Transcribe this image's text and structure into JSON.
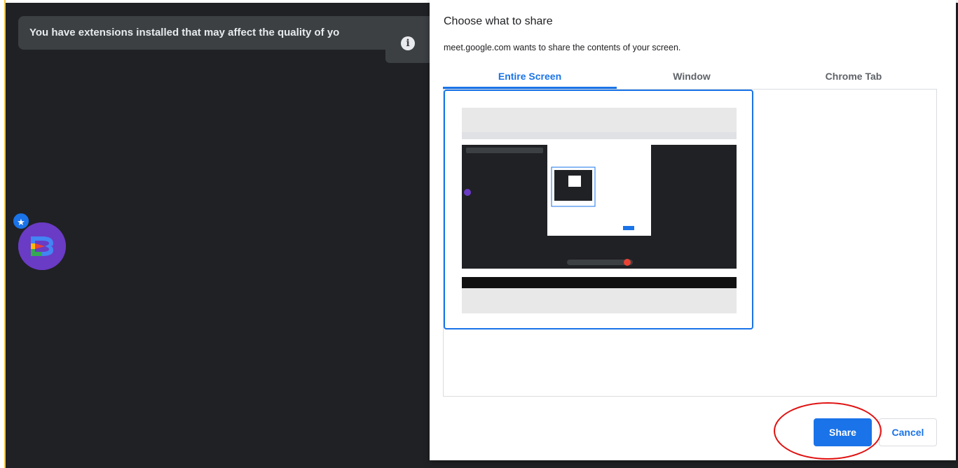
{
  "meet": {
    "extension_banner": "You have extensions installed that may affect the quality of yo",
    "info_icon": "info-icon",
    "extension_badge_icon": "star-icon",
    "extension_avatar": "extension-logo-icon"
  },
  "dialog": {
    "title": "Choose what to share",
    "subtitle": "meet.google.com wants to share the contents of your screen.",
    "tabs": [
      {
        "label": "Entire Screen",
        "active": true
      },
      {
        "label": "Window",
        "active": false
      },
      {
        "label": "Chrome Tab",
        "active": false
      }
    ],
    "share_label": "Share",
    "cancel_label": "Cancel"
  },
  "colors": {
    "accent": "#1a73e8",
    "meet_bg": "#202124",
    "annotation": "#e01010"
  }
}
